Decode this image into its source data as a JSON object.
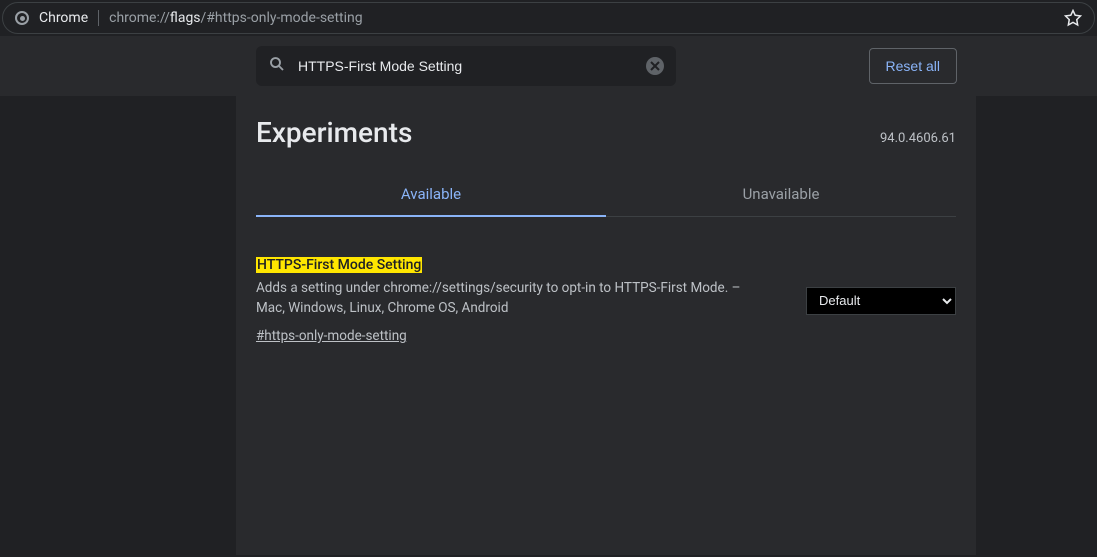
{
  "address_bar": {
    "browser": "Chrome",
    "url_scheme": "chrome://",
    "url_host": "flags",
    "url_path": "/#https-only-mode-setting"
  },
  "toolbar": {
    "search_value": "HTTPS-First Mode Setting",
    "reset_label": "Reset all"
  },
  "header": {
    "title": "Experiments",
    "version": "94.0.4606.61"
  },
  "tabs": {
    "available": "Available",
    "unavailable": "Unavailable"
  },
  "flag": {
    "title": "HTTPS-First Mode Setting",
    "description": "Adds a setting under chrome://settings/security to opt-in to HTTPS-First Mode. – Mac, Windows, Linux, Chrome OS, Android",
    "hash": "#https-only-mode-setting",
    "select_value": "Default"
  }
}
